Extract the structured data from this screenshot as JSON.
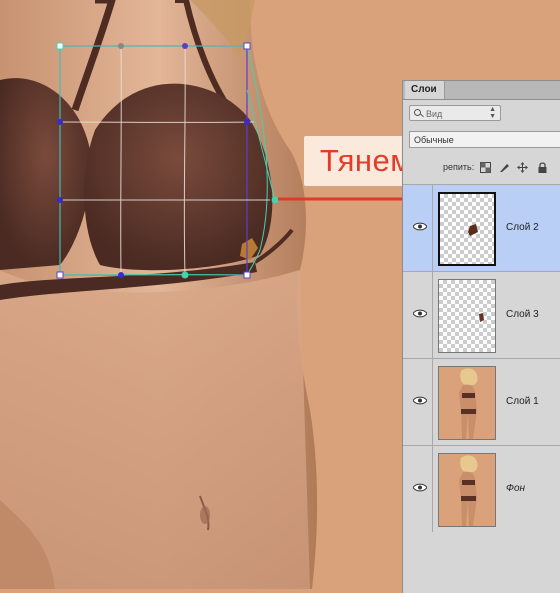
{
  "callout": {
    "text": "Тянем"
  },
  "layers_panel": {
    "tab_label": "Слои",
    "filter": {
      "label": "Вид",
      "icon": "search-icon"
    },
    "blend_mode": "Обычные",
    "lock_label": "репить:",
    "lock_icons": [
      "lock-transparent-pixels-icon",
      "lock-image-pixels-icon",
      "lock-position-icon",
      "lock-all-icon"
    ],
    "layers": [
      {
        "name": "Слой 2",
        "selected": true,
        "thumbnail": "transparent-with-fragment",
        "visible": true
      },
      {
        "name": "Слой 3",
        "selected": false,
        "thumbnail": "transparent-with-fragment",
        "visible": true
      },
      {
        "name": "Слой 1",
        "selected": false,
        "thumbnail": "photo",
        "visible": true
      },
      {
        "name": "Фон",
        "selected": false,
        "thumbnail": "photo",
        "visible": true,
        "italic": true
      }
    ]
  },
  "colors": {
    "background": "#d9a27a",
    "callout_text": "#e23c2a",
    "arrow": "#e03a28",
    "warp_frame": "#5b3fc9",
    "warp_grid": "#3fd3b0",
    "selected_layer": "#b9cff5"
  }
}
